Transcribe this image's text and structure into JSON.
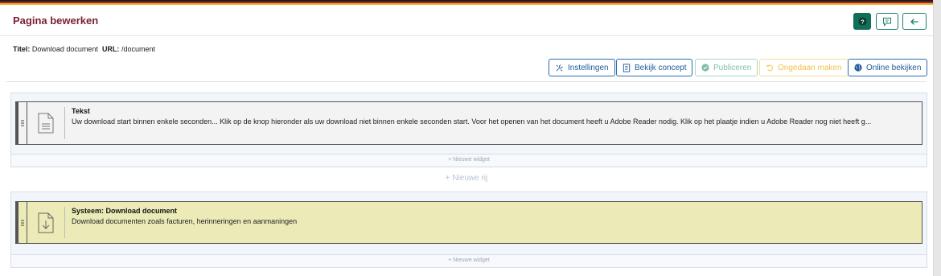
{
  "header": {
    "title": "Pagina bewerken",
    "help_icon": "question-icon",
    "feedback_icon": "comment-icon",
    "back_icon": "arrow-left-icon"
  },
  "meta": {
    "title_label": "Titel:",
    "title_value": "Download document",
    "url_label": "URL:",
    "url_value": "/document"
  },
  "toolbar": {
    "settings": "Instellingen",
    "preview": "Bekijk concept",
    "publish": "Publiceren",
    "undo": "Ongedaan maken",
    "online": "Online bekijken"
  },
  "rows": [
    {
      "widget_title": "Tekst",
      "widget_text": "Uw download start binnen enkele seconden... Klik op de knop hieronder als uw download niet binnen enkele seconden start. Voor het openen van het document heeft u Adobe Reader nodig. Klik op het plaatje indien u Adobe Reader nog niet heeft g...",
      "icon": "document-icon",
      "new_widget": "+ Nieuwe widget"
    },
    {
      "widget_title": "Systeem: Download document",
      "widget_text": "Download documenten zoals facturen, herinneringen en aanmaningen",
      "icon": "download-file-icon",
      "new_widget": "+ Nieuwe widget"
    }
  ],
  "new_row": "+ Nieuwe rij",
  "colors": {
    "title": "#7a1e33",
    "primary": "#1f5a98",
    "success": "#1a7f68",
    "text_widget_bg": "#f3f3f3",
    "system_widget_bg": "#ecebb8"
  }
}
